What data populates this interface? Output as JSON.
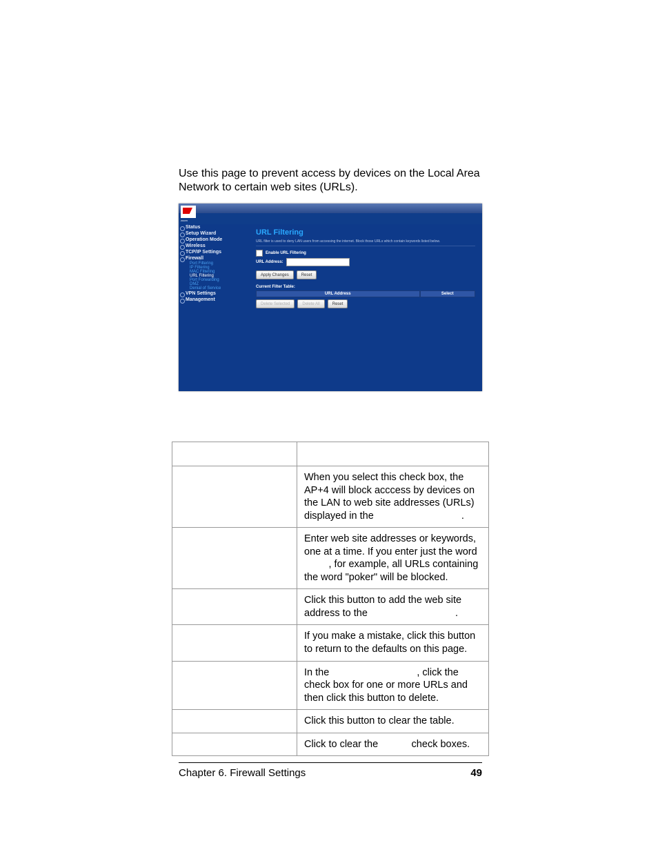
{
  "intro": "Use this page to prevent access by devices on the Local Area Network to certain web sites (URLs).",
  "screenshot": {
    "sidebar": {
      "items": [
        {
          "label": "Status"
        },
        {
          "label": "Setup Wizard"
        },
        {
          "label": "Operation Mode"
        },
        {
          "label": "Wireless"
        },
        {
          "label": "TCP/IP Settings"
        },
        {
          "label": "Firewall"
        }
      ],
      "subs": [
        {
          "label": "Port Filtering"
        },
        {
          "label": "IP Filtering"
        },
        {
          "label": "MAC Filtering"
        },
        {
          "label": "URL Filtering",
          "active": true
        },
        {
          "label": "Port Forwarding"
        },
        {
          "label": "DMZ"
        },
        {
          "label": "Denial of Service"
        }
      ],
      "items2": [
        {
          "label": "VPN Settings"
        },
        {
          "label": "Management"
        }
      ]
    },
    "content": {
      "title": "URL Filtering",
      "desc": "URL filter is used to deny LAN users from accessing the internet. Block those URLs which contain keywords listed below.",
      "enable_label": "Enable URL Filtering",
      "url_label": "URL Address:",
      "apply": "Apply Changes",
      "reset": "Reset",
      "table_caption": "Current Filter Table:",
      "col1": "URL Address",
      "col2": "Select",
      "del_sel": "Delete Selected",
      "del_all": "Delete All",
      "reset2": "Reset"
    }
  },
  "table": {
    "rows": [
      {
        "d": "When you select this check box, the AP+4 will block acccess by devices on the LAN to web site addresses (URLs) displayed in the ",
        "d2": "."
      },
      {
        "d": "Enter web site addresses or keywords, one at a time. If you enter just the word ",
        "kw": "",
        "d2": ", for example, all URLs containing the word \"poker\" will be blocked."
      },
      {
        "d": "Click this button to add the web site address to the ",
        "d2": "."
      },
      {
        "d": "If you make a mistake, click this button to return to the defaults on this page."
      },
      {
        "d": "In the ",
        "mid": "",
        "d2": ", click the check box for one or more URLs and then click this button to delete."
      },
      {
        "d": "Click this button to clear the table."
      },
      {
        "d": "Click to clear the ",
        "mid": "",
        "d2": " check boxes."
      }
    ]
  },
  "footer": {
    "left": "Chapter 6. Firewall Settings",
    "right": "49"
  }
}
